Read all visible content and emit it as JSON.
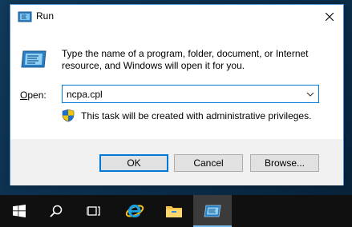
{
  "dialog": {
    "title": "Run",
    "description": "Type the name of a program, folder, document, or Internet resource, and Windows will open it for you.",
    "open_label_prefix": "",
    "open_label_mnemonic": "O",
    "open_label_rest": "pen:",
    "open_value": "ncpa.cpl",
    "admin_note": "This task will be created with administrative privileges.",
    "buttons": {
      "ok": "OK",
      "cancel": "Cancel",
      "browse": "Browse..."
    }
  },
  "taskbar": {
    "items": [
      {
        "icon": "windows-start-icon"
      },
      {
        "icon": "search-icon"
      },
      {
        "icon": "task-view-icon"
      },
      {
        "icon": "internet-explorer-icon"
      },
      {
        "icon": "file-explorer-icon"
      },
      {
        "icon": "run-app-icon",
        "active": true
      }
    ]
  },
  "colors": {
    "accent": "#0078d7",
    "taskbar": "#101010",
    "footer": "#f0f0f0"
  }
}
